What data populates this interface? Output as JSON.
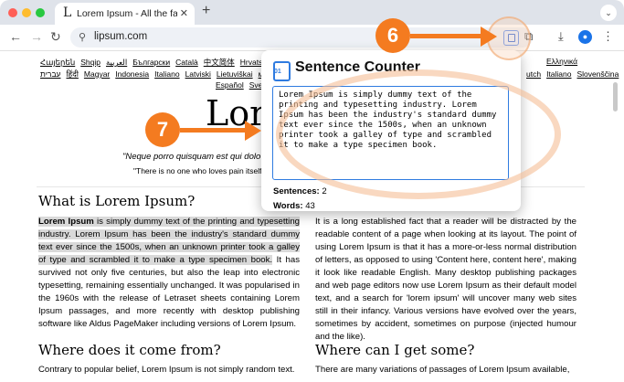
{
  "browser": {
    "tab_title": "Lorem Ipsum - All the facts - Lipsum",
    "tab_favicon": "L",
    "close_glyph": "✕",
    "new_tab_glyph": "+",
    "tab_menu_glyph": "⌄",
    "url": "lipsum.com",
    "icons": [
      "back-icon",
      "forward-icon",
      "reload-icon",
      "site-info-icon",
      "extension-icon",
      "puzzle-icon",
      "download-icon",
      "profile-icon",
      "menu-icon"
    ]
  },
  "page": {
    "lang_row1": [
      "Հայերեն",
      "Shqip",
      "العربية",
      "Български",
      "Català",
      "中文简体",
      "Hrvatski",
      "Česky"
    ],
    "lang_row1_right": [
      "Ελληνικά"
    ],
    "lang_row2": [
      "עברית",
      "हिंदी",
      "Magyar",
      "Indonesia",
      "Italiano",
      "Latviski",
      "Lietuviškai",
      "македо"
    ],
    "lang_row2_right": [
      "utch",
      "Italiano",
      "Slovenščina"
    ],
    "lang_row3": [
      "Español",
      "Sven"
    ],
    "big_title": "Lore",
    "quote": "\"Neque porro quisquam est qui dolo",
    "quote2": "\"There is no one who loves pain itself, w",
    "h_what": "What is Lorem Ipsum?",
    "p_what_bold": "Lorem Ipsum",
    "p_what_highlight": " is simply dummy text of the printing and typesetting industry. Lorem Ipsum has been the industry's standard dummy text ever since the 1500s, when an unknown printer took a galley of type and scrambled it to make a type specimen book.",
    "p_what_rest": " It has survived not only five centuries, but also the leap into electronic typesetting, remaining essentially unchanged. It was popularised in the 1960s with the release of Letraset sheets containing Lorem Ipsum passages, and more recently with desktop publishing software like Aldus PageMaker including versions of Lorem Ipsum.",
    "p_why": "It is a long established fact that a reader will be distracted by the readable content of a page when looking at its layout. The point of using Lorem Ipsum is that it has a more-or-less normal distribution of letters, as opposed to using 'Content here, content here', making it look like readable English. Many desktop publishing packages and web page editors now use Lorem Ipsum as their default model text, and a search for 'lorem ipsum' will uncover many web sites still in their infancy. Various versions have evolved over the years, sometimes by accident, sometimes on purpose (injected humour and the like).",
    "h_where_from": "Where does it come from?",
    "p_where_from": "Contrary to popular belief, Lorem Ipsum is not simply random text.",
    "h_where_get": "Where can I get some?",
    "p_where_get": "There are many variations of passages of Lorem Ipsum available,"
  },
  "popup": {
    "icon_label": "01",
    "title": "Sentence Counter",
    "text": "Lorem Ipsum is simply dummy text of the printing and typesetting industry. Lorem Ipsum has been the industry's standard dummy text ever since the 1500s, when an unknown printer took a galley of type and scrambled it to make a type specimen book.",
    "sentences_label": "Sentences:",
    "sentences_value": "2",
    "words_label": "Words:",
    "words_value": "43"
  },
  "annotations": {
    "step6": "6",
    "step7": "7",
    "color": "#f47b20"
  }
}
